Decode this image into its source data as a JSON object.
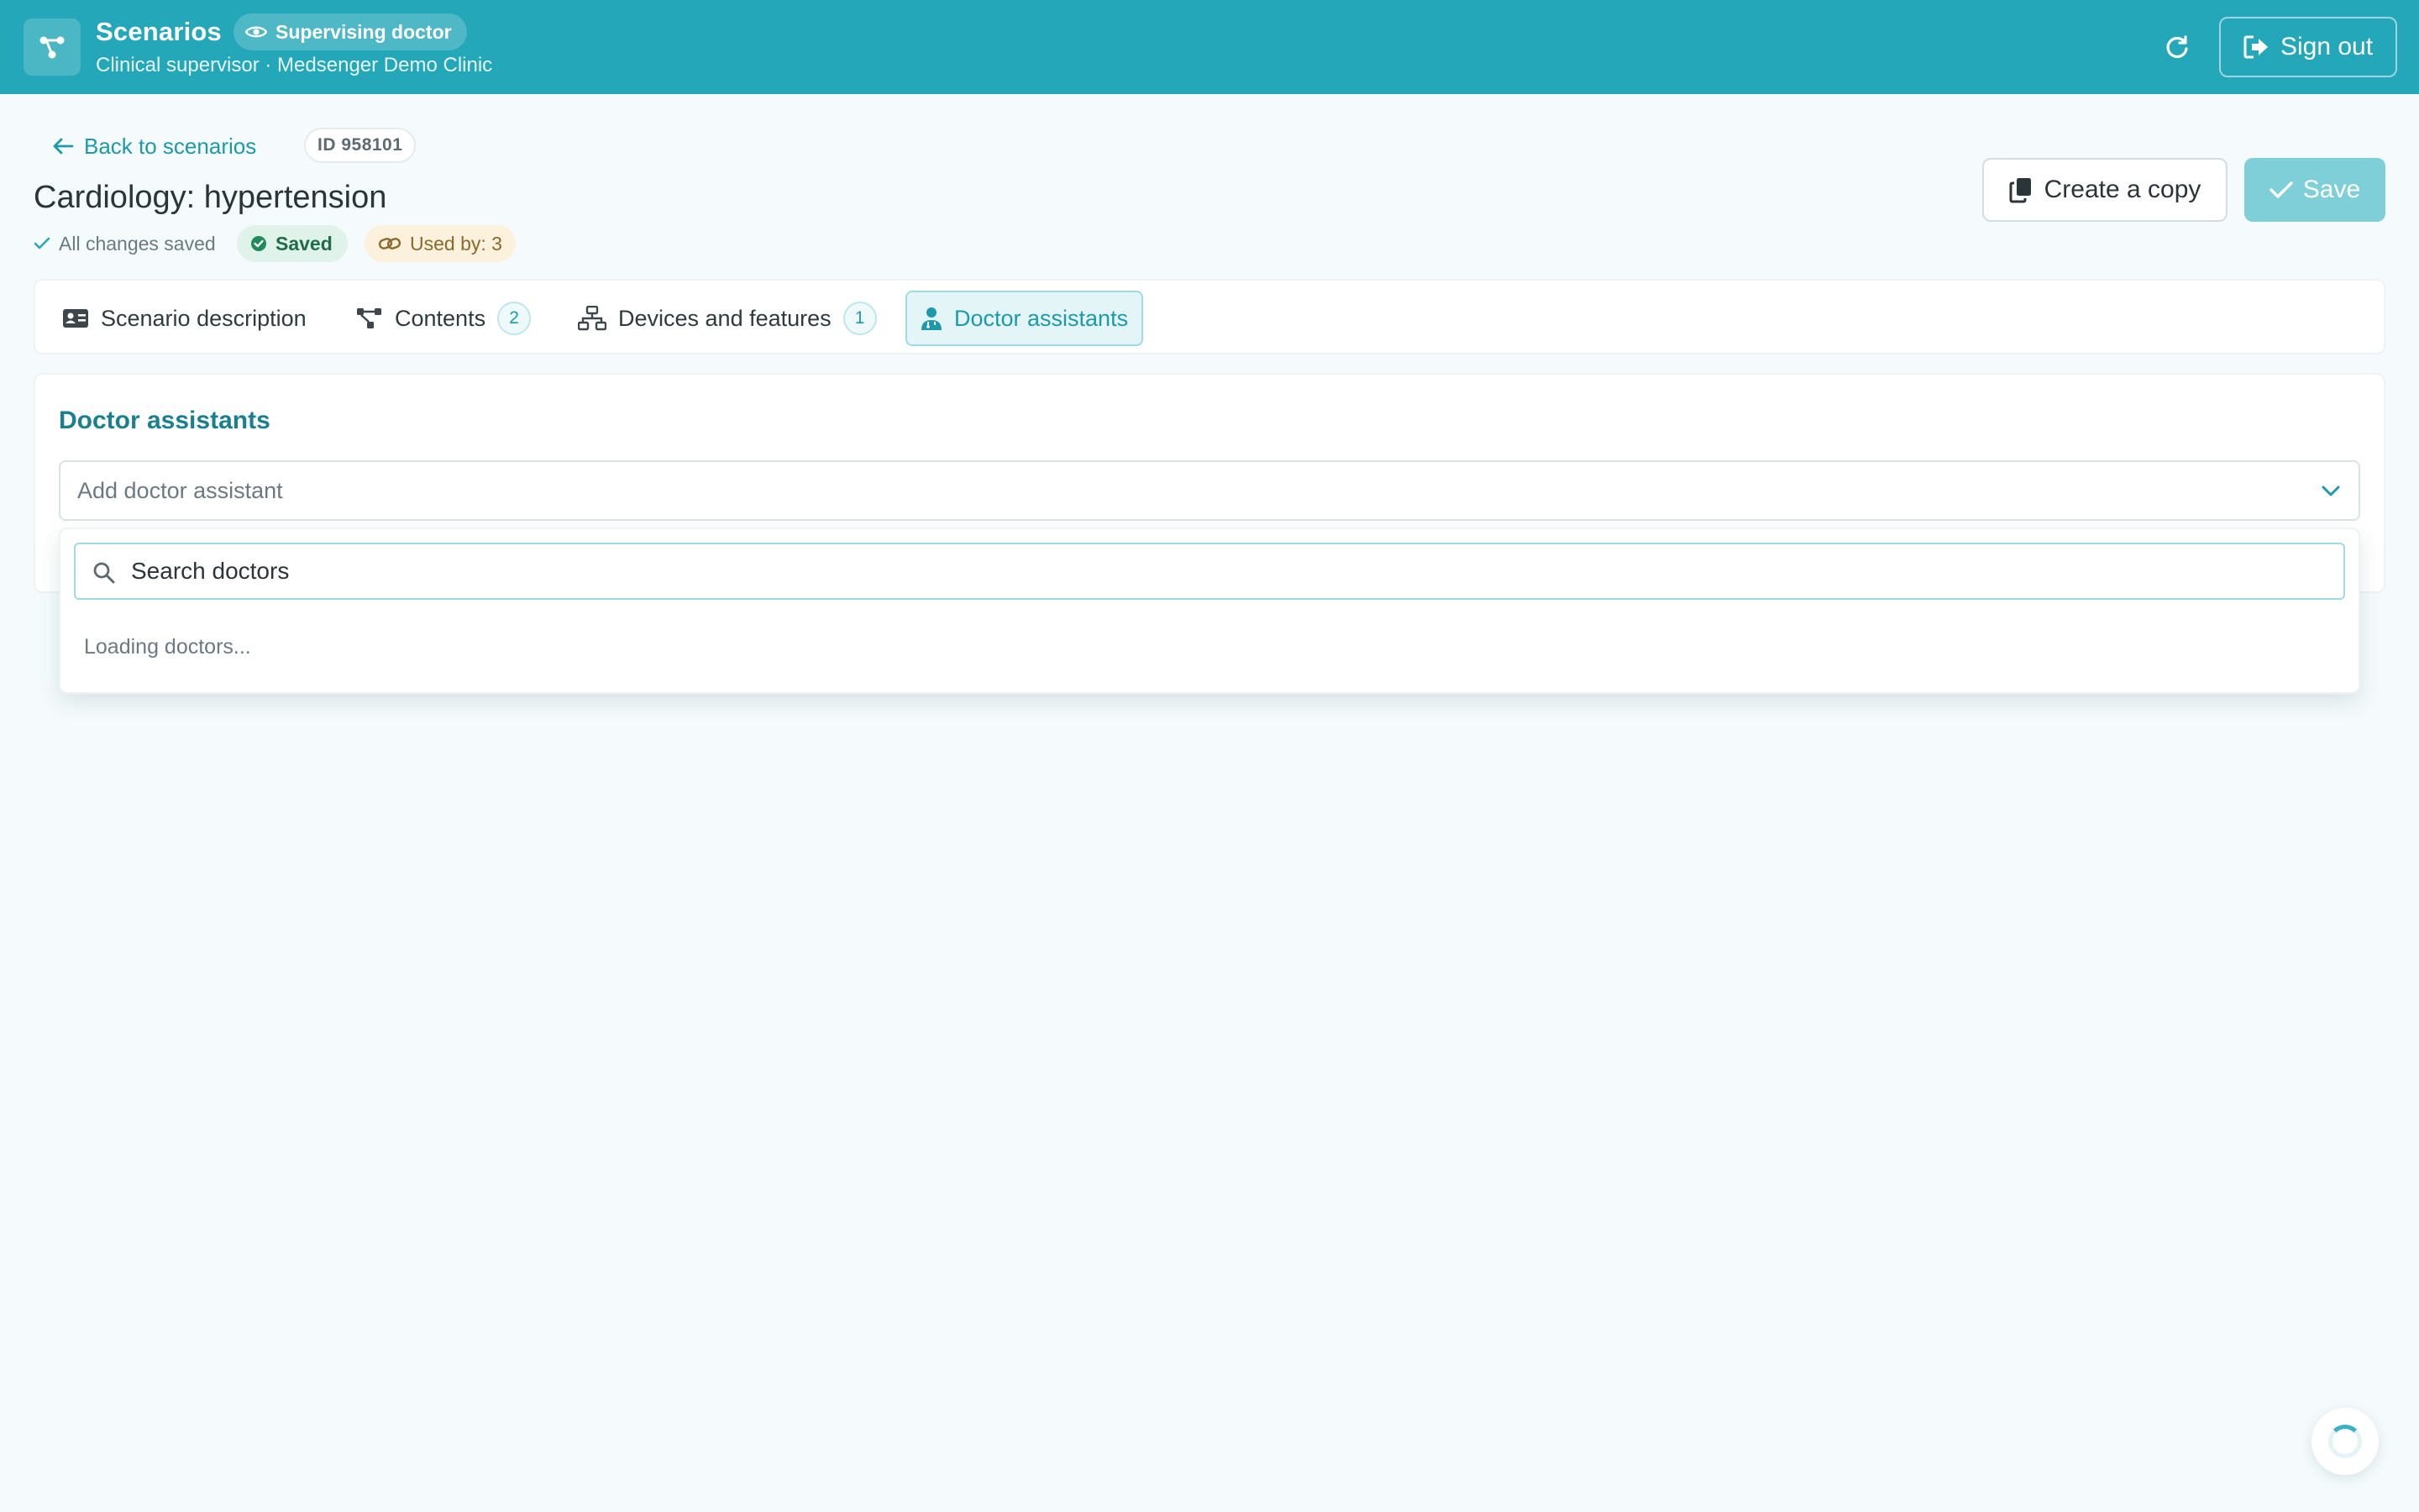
{
  "header": {
    "app_title": "Scenarios",
    "role_label": "Supervising doctor",
    "subtitle": "Clinical supervisor · Medsenger Demo Clinic",
    "sign_out_label": "Sign out",
    "bg_color": "#24a7b8"
  },
  "scenario": {
    "back_label": "Back to scenarios",
    "id_label": "ID 958101",
    "title": "Cardiology: hypertension",
    "status_text": "All changes saved",
    "saved_badge": "Saved",
    "used_by": "Used by: 3",
    "copy_label": "Create a copy",
    "save_label": "Save"
  },
  "tabs": [
    {
      "label": "Scenario description",
      "count": "",
      "icon": "id-card-icon",
      "active": false
    },
    {
      "label": "Contents",
      "count": "2",
      "icon": "nodes-icon",
      "active": false
    },
    {
      "label": "Devices and features",
      "count": "1",
      "icon": "network-icon",
      "active": false
    },
    {
      "label": "Doctor assistants",
      "count": "",
      "icon": "doctor-icon",
      "active": true
    }
  ],
  "assistants": {
    "section_title": "Doctor assistants",
    "select_placeholder": "Add doctor assistant",
    "search_placeholder": "Search doctors",
    "loading_text": "Loading doctors..."
  },
  "colors": {
    "accent": "#1c9aab",
    "save_button": "#7fcfd9",
    "saved_badge_bg": "#e0f3ea",
    "used_by_bg": "#fbf1dc"
  }
}
